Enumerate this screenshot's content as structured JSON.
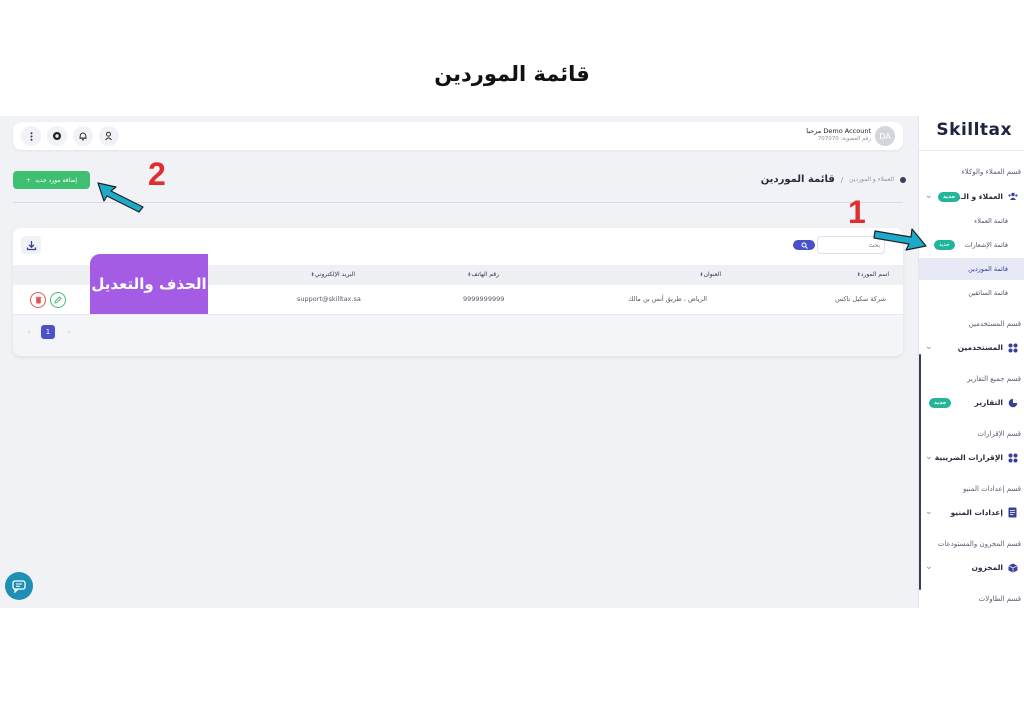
{
  "page_title": "قائمة الموردين",
  "sidebar": {
    "brand": "Skilltax",
    "new_badge": "جديد",
    "sections": [
      {
        "label": "قسم العملاء والوكلاء",
        "group": "العملاء و الـ...",
        "icon": "users-icon",
        "badge": "جديد",
        "children": [
          {
            "label": "قائمة العملاء"
          },
          {
            "label": "قائمة الإشعارات",
            "badge": "جديد"
          },
          {
            "label": "قائمة الموردين",
            "active": true
          },
          {
            "label": "قائمة السائقين"
          }
        ]
      },
      {
        "label": "قسم المستخدمين",
        "group": "المستخدمين",
        "icon": "grid-icon"
      },
      {
        "label": "قسم جميع التقارير",
        "group": "التقارير",
        "icon": "pie-chart-icon",
        "badge": "جديد"
      },
      {
        "label": "قسم الإقرارات",
        "group": "الإقرارات الضريبية",
        "icon": "grid-icon"
      },
      {
        "label": "قسم إعدادات المنيو",
        "group": "إعدادات المنيو",
        "icon": "document-icon"
      },
      {
        "label": "قسم المخزون والمستودعات",
        "group": "المخزون",
        "icon": "box-icon"
      },
      {
        "label": "قسم الطاولات"
      }
    ]
  },
  "topbar": {
    "account_name": "Demo Account  مرحبا",
    "account_number": "رقم العضوية: 707070",
    "avatar_initials": "DA",
    "icons": [
      "more-vertical-icon",
      "settings-icon",
      "bell-icon",
      "user-voice-icon"
    ]
  },
  "header": {
    "breadcrumb_parent": "العملاء و الموردين",
    "breadcrumb_sep": "/",
    "breadcrumb_current": "قائمة الموردين",
    "add_button_label": "إضافة مورد جديد",
    "add_button_icon": "+"
  },
  "annotations": {
    "step1": "1",
    "step2": "2",
    "callout": "الحذف والتعديل",
    "step_color": "#e02d2d",
    "arrow_color": "#1da9c9",
    "callout_color": "#a45ce5"
  },
  "table": {
    "search_placeholder": "بحث",
    "columns": [
      "اسم المورد",
      "العنوان",
      "رقم الهاتف",
      "البريد الإلكتروني"
    ],
    "rows": [
      {
        "name": "شركة سكيل تاكس",
        "address": "الرياض ، طريق أنس بن مالك",
        "phone": "9999999999",
        "email": "support@skilltax.sa"
      }
    ],
    "pagination": {
      "current": "1",
      "prev": "‹",
      "next": "›"
    }
  },
  "colors": {
    "primary": "#4b52c8",
    "green": "#3fbf72",
    "badge": "#22b59a",
    "danger": "#e05555"
  }
}
